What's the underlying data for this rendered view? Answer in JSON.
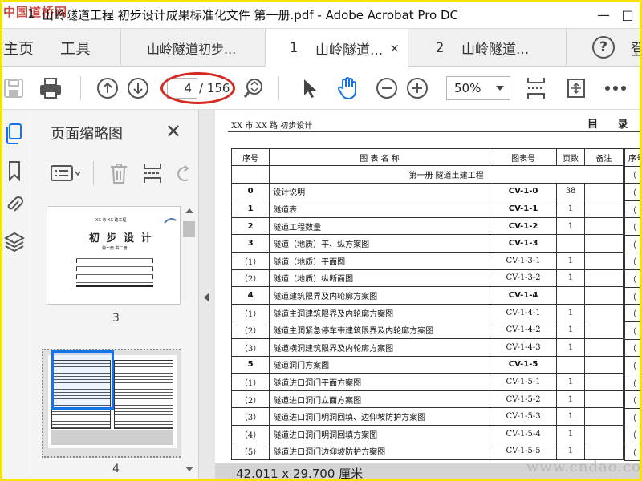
{
  "watermark_top": "中国道桥网",
  "watermark_bottom": "www.cndao.com",
  "window": {
    "number": "1",
    "title": "山岭隧道工程 初步设计成果标准化文件 第一册.pdf - Adobe Acrobat Pro DC",
    "minimize": "—",
    "maximize": "□"
  },
  "tabs": {
    "home": "主页",
    "tools": "工具",
    "tab0_label": "山岭隧道初步...",
    "doc_tabs": [
      {
        "num": "1",
        "label": "山岭隧道...",
        "close": "×"
      },
      {
        "num": "2",
        "label": "山岭隧道..."
      }
    ],
    "help": "?",
    "cut_label": "登"
  },
  "toolbar": {
    "page_current": "4",
    "page_total": "/ 156",
    "zoom": "50%"
  },
  "panel": {
    "title": "页面缩略图",
    "close": "✕",
    "thumbnails": [
      {
        "page_number": "3",
        "title": "初 步 设 计",
        "top_text": "XX 市 XX 路工程",
        "sub_text": "第一册  共二册"
      },
      {
        "page_number": "4"
      }
    ]
  },
  "document": {
    "header_left": "XX 市 XX 路  初步设计",
    "header_right": "目  录",
    "columns": [
      "序号",
      "图  表  名  称",
      "图表号",
      "页数",
      "备注"
    ],
    "section_title": "第一册    隧道土建工程",
    "rows": [
      {
        "no": "0",
        "name": "设计说明",
        "code": "CV-1-0",
        "pages": "38",
        "bold": true
      },
      {
        "no": "1",
        "name": "隧道表",
        "code": "CV-1-1",
        "pages": "1",
        "bold": true
      },
      {
        "no": "2",
        "name": "隧道工程数量",
        "code": "CV-1-2",
        "pages": "1",
        "bold": true
      },
      {
        "no": "3",
        "name": "隧道（地质）平、纵方案图",
        "code": "CV-1-3",
        "pages": "",
        "bold": true
      },
      {
        "no": "（1）",
        "name": "隧道（地质）平面图",
        "code": "CV-1-3-1",
        "pages": "1",
        "bold": false
      },
      {
        "no": "（2）",
        "name": "隧道（地质）纵断面图",
        "code": "CV-1-3-2",
        "pages": "1",
        "bold": false
      },
      {
        "no": "4",
        "name": "隧道建筑限界及内轮廓方案图",
        "code": "CV-1-4",
        "pages": "",
        "bold": true
      },
      {
        "no": "（1）",
        "name": "隧道主洞建筑限界及内轮廓方案图",
        "code": "CV-1-4-1",
        "pages": "1",
        "bold": false
      },
      {
        "no": "（2）",
        "name": "隧道主洞紧急停车带建筑限界及内轮廓方案图",
        "code": "CV-1-4-2",
        "pages": "1",
        "bold": false
      },
      {
        "no": "（3）",
        "name": "隧道横洞建筑限界及内轮廓方案图",
        "code": "CV-1-4-3",
        "pages": "1",
        "bold": false
      },
      {
        "no": "5",
        "name": "隧道洞门方案图",
        "code": "CV-1-5",
        "pages": "",
        "bold": true
      },
      {
        "no": "（1）",
        "name": "隧道进口洞门平面方案图",
        "code": "CV-1-5-1",
        "pages": "1",
        "bold": false
      },
      {
        "no": "（2）",
        "name": "隧道进口洞门立面方案图",
        "code": "CV-1-5-2",
        "pages": "1",
        "bold": false
      },
      {
        "no": "（3）",
        "name": "隧道进口洞门明洞回填、边仰坡防护方案图",
        "code": "CV-1-5-3",
        "pages": "1",
        "bold": false
      },
      {
        "no": "（4）",
        "name": "隧道进口洞门明洞回填方案图",
        "code": "CV-1-5-4",
        "pages": "1",
        "bold": false
      },
      {
        "no": "（5）",
        "name": "隧道进口洞门边仰坡防护方案图",
        "code": "CV-1-5-5",
        "pages": "1",
        "bold": false
      }
    ],
    "right_col_header": "序号",
    "right_col_cells": [
      "（",
      "（",
      "（",
      "（",
      "（",
      "（",
      "（",
      "（",
      "（",
      "（",
      "（",
      "（",
      "（",
      "（",
      "（",
      "（",
      "（"
    ]
  },
  "status": {
    "dimensions": "42.011 x 29.700 厘米"
  },
  "colors": {
    "annotation_red": "#d42a20",
    "frame_yellow": "#f2e500",
    "hand_tool_blue": "#1473e6"
  }
}
